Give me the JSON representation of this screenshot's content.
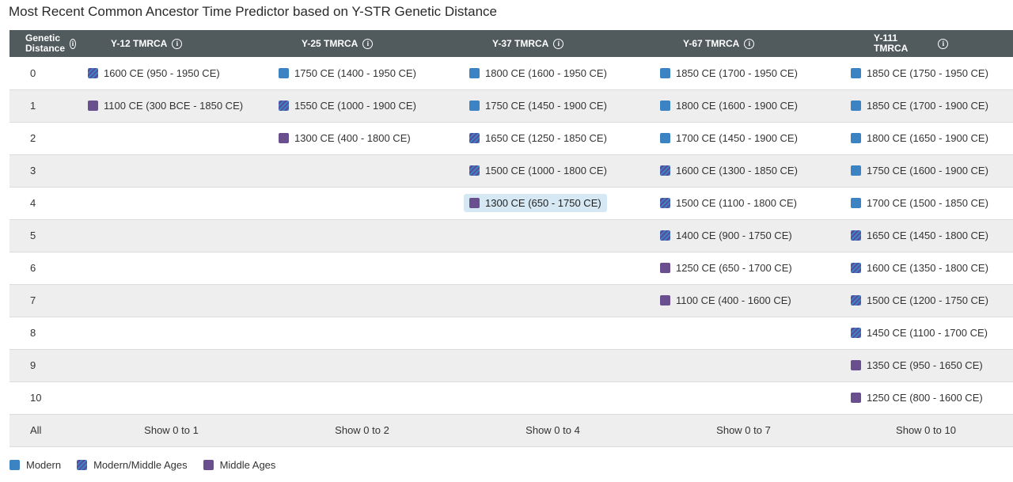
{
  "title": "Most Recent Common Ancestor Time Predictor based on Y-STR Genetic Distance",
  "columns": {
    "gd": [
      "Genetic",
      "Distance"
    ],
    "y12": "Y-12 TMRCA",
    "y25": "Y-25 TMRCA",
    "y37": "Y-37 TMRCA",
    "y67": "Y-67 TMRCA",
    "y111": [
      "Y-111",
      "TMRCA"
    ]
  },
  "info_icon": "i",
  "rows": [
    {
      "gd": "0",
      "y12": "1600 CE (950 - 1950 CE)",
      "y25": "1750 CE (1400 - 1950 CE)",
      "y37": "1800 CE (1600 - 1950 CE)",
      "y67": "1850 CE (1700 - 1950 CE)",
      "y111": "1850 CE (1750 - 1950 CE)"
    },
    {
      "gd": "1",
      "y12": "1100 CE (300 BCE - 1850 CE)",
      "y25": "1550 CE (1000 - 1900 CE)",
      "y37": "1750 CE (1450 - 1900 CE)",
      "y67": "1800 CE (1600 - 1900 CE)",
      "y111": "1850 CE (1700 - 1900 CE)"
    },
    {
      "gd": "2",
      "y12": "",
      "y25": "1300 CE (400 - 1800 CE)",
      "y37": "1650 CE (1250 - 1850 CE)",
      "y67": "1700 CE (1450 - 1900 CE)",
      "y111": "1800 CE (1650 - 1900 CE)"
    },
    {
      "gd": "3",
      "y12": "",
      "y25": "",
      "y37": "1500 CE (1000 - 1800 CE)",
      "y67": "1600 CE (1300 - 1850 CE)",
      "y111": "1750 CE (1600 - 1900 CE)"
    },
    {
      "gd": "4",
      "y12": "",
      "y25": "",
      "y37": "1300 CE (650 - 1750 CE)",
      "y67": "1500 CE (1100 - 1800 CE)",
      "y111": "1700 CE (1500 - 1850 CE)"
    },
    {
      "gd": "5",
      "y12": "",
      "y25": "",
      "y37": "",
      "y67": "1400 CE (900 - 1750 CE)",
      "y111": "1650 CE (1450 - 1800 CE)"
    },
    {
      "gd": "6",
      "y12": "",
      "y25": "",
      "y37": "",
      "y67": "1250 CE (650 - 1700 CE)",
      "y111": "1600 CE (1350 - 1800 CE)"
    },
    {
      "gd": "7",
      "y12": "",
      "y25": "",
      "y37": "",
      "y67": "1100 CE (400 - 1600 CE)",
      "y111": "1500 CE (1200 - 1750 CE)"
    },
    {
      "gd": "8",
      "y12": "",
      "y25": "",
      "y37": "",
      "y67": "",
      "y111": "1450 CE (1100 - 1700 CE)"
    },
    {
      "gd": "9",
      "y12": "",
      "y25": "",
      "y37": "",
      "y67": "",
      "y111": "1350 CE (950 - 1650 CE)"
    },
    {
      "gd": "10",
      "y12": "",
      "y25": "",
      "y37": "",
      "y67": "",
      "y111": "1250 CE (800 - 1600 CE)"
    }
  ],
  "era_codes": {
    "comment_free": true,
    "0": {
      "y12": "mm",
      "y25": "modern",
      "y37": "modern",
      "y67": "modern",
      "y111": "modern"
    },
    "1": {
      "y12": "middle",
      "y25": "mm",
      "y37": "modern",
      "y67": "modern",
      "y111": "modern"
    },
    "2": {
      "y25": "middle",
      "y37": "mm",
      "y67": "modern",
      "y111": "modern"
    },
    "3": {
      "y37": "mm",
      "y67": "mm",
      "y111": "modern"
    },
    "4": {
      "y37": "middle",
      "y67": "mm",
      "y111": "modern"
    },
    "5": {
      "y67": "mm",
      "y111": "mm"
    },
    "6": {
      "y67": "middle",
      "y111": "mm"
    },
    "7": {
      "y67": "middle",
      "y111": "mm"
    },
    "8": {
      "y111": "mm"
    },
    "9": {
      "y111": "middle"
    },
    "10": {
      "y111": "middle"
    }
  },
  "highlighted_cell": {
    "row": "4",
    "col": "y37"
  },
  "all_row": {
    "label": "All",
    "y12": "Show 0 to 1",
    "y25": "Show 0 to 2",
    "y37": "Show 0 to 4",
    "y67": "Show 0 to 7",
    "y111": "Show 0 to 10"
  },
  "legend": {
    "modern": "Modern",
    "mm": "Modern/Middle Ages",
    "middle": "Middle Ages"
  },
  "colors": {
    "header_bg": "#515a5c",
    "modern": "#3b83c3",
    "middle": "#6a4f8e",
    "highlight": "#d5e8f4"
  }
}
